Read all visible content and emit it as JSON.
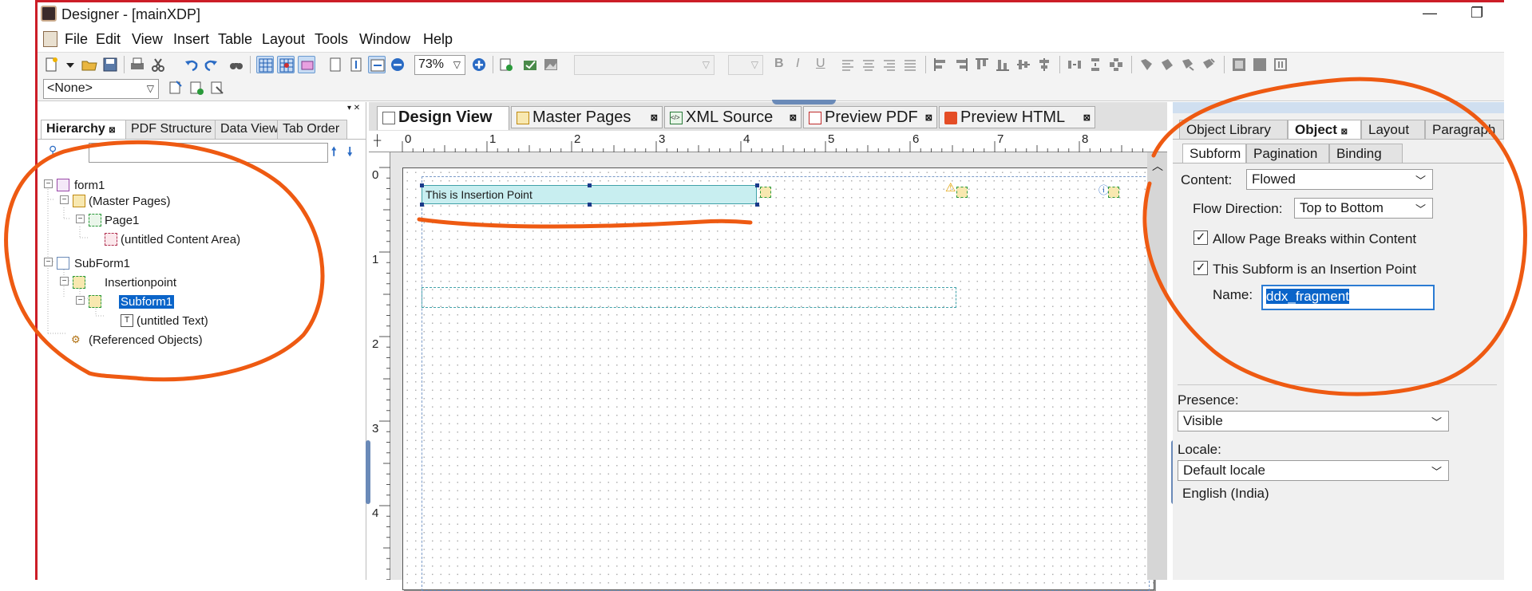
{
  "window": {
    "title": "Designer - [mainXDP]",
    "app_icon": "designer-app-icon",
    "minimize": "—",
    "restore": "❐"
  },
  "menu": [
    "File",
    "Edit",
    "View",
    "Insert",
    "Table",
    "Layout",
    "Tools",
    "Window",
    "Help"
  ],
  "toolbar": {
    "zoom": "73%",
    "font_name": "",
    "font_size": "",
    "scope_select": "<None>",
    "bold": "B",
    "italic": "I",
    "underline": "U"
  },
  "left_panel": {
    "tabs": [
      "Hierarchy",
      "PDF Structure",
      "Data View",
      "Tab Order"
    ],
    "tree": {
      "form1": "form1",
      "master_pages": "(Master Pages)",
      "page1": "Page1",
      "content_area": "(untitled Content Area)",
      "subform1_root": "SubForm1",
      "insertion_point": "Insertionpoint",
      "subform1_selected": "Subform1",
      "untitled_text": "(untitled Text)",
      "referenced": "(Referenced Objects)"
    }
  },
  "document_tabs": [
    "Design View",
    "Master Pages",
    "XML Source",
    "Preview PDF",
    "Preview HTML"
  ],
  "ruler": {
    "horizontal": [
      "0",
      "1",
      "2",
      "3",
      "4",
      "5",
      "6",
      "7",
      "8"
    ],
    "vertical": [
      "0",
      "1",
      "2",
      "3",
      "4"
    ]
  },
  "canvas": {
    "field_text": "This is Insertion Point"
  },
  "right_panel": {
    "tabs": [
      "Object Library",
      "Object",
      "Layout",
      "Paragraph"
    ],
    "subtabs": [
      "Subform",
      "Pagination",
      "Binding"
    ],
    "content_label": "Content:",
    "content_value": "Flowed",
    "flow_label": "Flow Direction:",
    "flow_value": "Top to Bottom",
    "allow_breaks": "Allow Page Breaks within Content",
    "is_insertion": "This Subform is an Insertion Point",
    "name_label": "Name:",
    "name_value": "ddx_fragment",
    "presence_label": "Presence:",
    "presence_value": "Visible",
    "locale_label": "Locale:",
    "locale_value": "Default locale",
    "locale_note": "English (India)"
  },
  "colors": {
    "annotation": "#ee5a12",
    "frame": "#cc1d27",
    "selection": "#0a64c9",
    "field_fill": "#c8eef0"
  }
}
